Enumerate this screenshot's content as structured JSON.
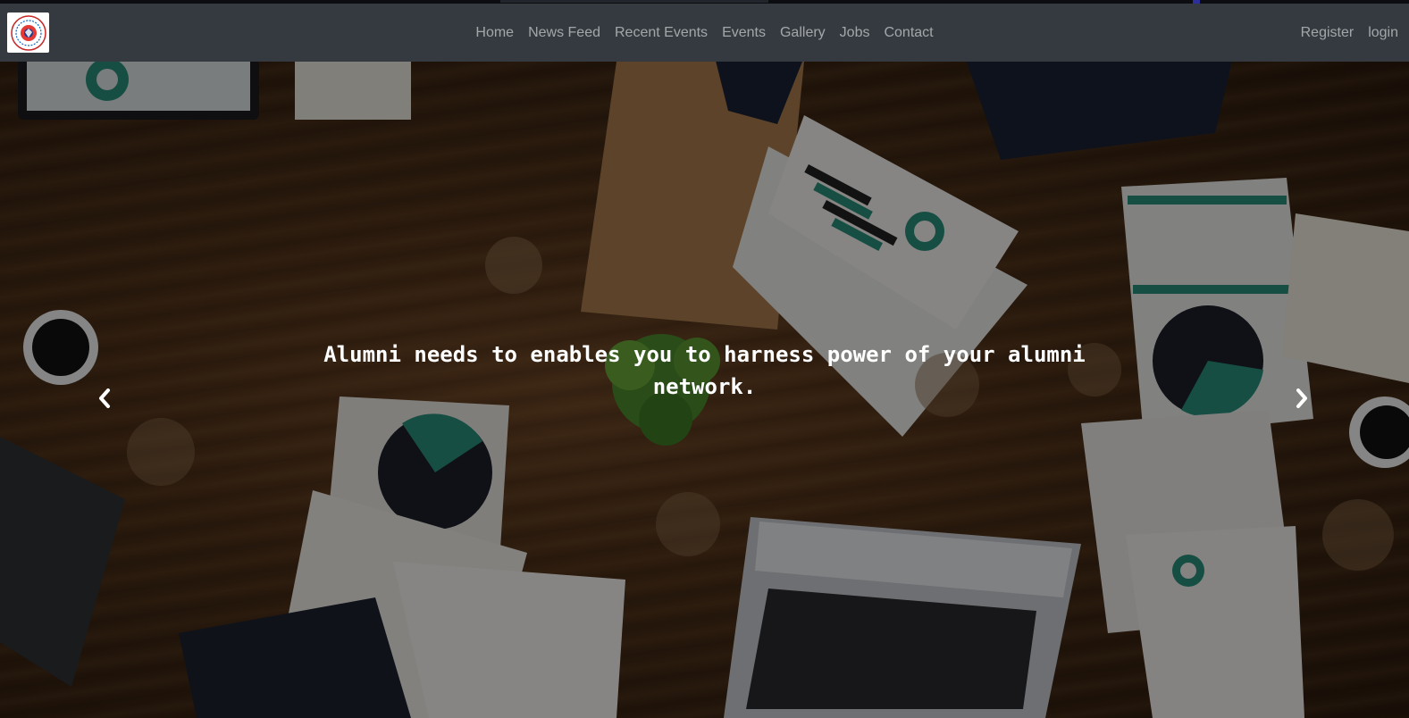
{
  "brand": {
    "logo_icon": "college-seal-logo-icon"
  },
  "nav": {
    "center_links": [
      {
        "label": "Home"
      },
      {
        "label": "News Feed"
      },
      {
        "label": "Recent Events"
      },
      {
        "label": "Events"
      },
      {
        "label": "Gallery"
      },
      {
        "label": "Jobs"
      },
      {
        "label": "Contact"
      }
    ],
    "right_links": [
      {
        "label": "Register"
      },
      {
        "label": "login"
      }
    ]
  },
  "carousel": {
    "caption": "Alumni needs to enables you to harness power of your alumni network.",
    "prev_icon": "chevron-left-icon",
    "next_icon": "chevron-right-icon"
  },
  "colors": {
    "navbar_bg": "#343a40",
    "nav_link": "rgba(255,255,255,0.55)",
    "caption_text": "#ffffff",
    "accent_teal": "#2a8f7a"
  }
}
